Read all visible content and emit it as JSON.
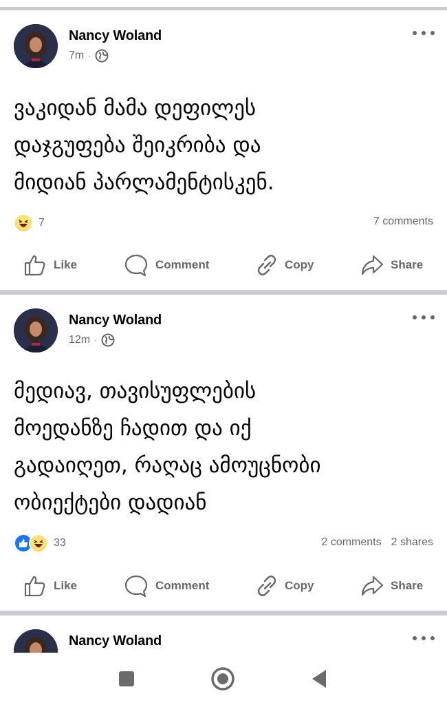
{
  "posts": [
    {
      "author": "Nancy Woland",
      "time": "7m",
      "separator": "·",
      "text": "ვაკიდან მამა დეფილეს\nდაჯგუფება შეიკრიბა და\nმიდიან პარლამენტისკენ.",
      "reaction_count": "7",
      "reactions": [
        "haha"
      ],
      "comments": "7 comments",
      "shares": ""
    },
    {
      "author": "Nancy Woland",
      "time": "12m",
      "separator": "·",
      "text": "მედიავ, თავისუფლების\nმოედანზე ჩადით და იქ\nგადაიღეთ, რაღაც ამოუცნობი\nობიექტები დადიან",
      "reaction_count": "33",
      "reactions": [
        "like",
        "haha"
      ],
      "comments": "2 comments",
      "shares": "2 shares"
    },
    {
      "author": "Nancy Woland"
    }
  ],
  "actions": {
    "like": "Like",
    "comment": "Comment",
    "copy": "Copy",
    "share": "Share"
  },
  "icons": {
    "privacy": "globe-icon",
    "more": "more-options-icon",
    "nav": [
      "recents-square-icon",
      "home-circle-icon",
      "back-triangle-icon"
    ]
  },
  "colors": {
    "secondary_text": "#65676b",
    "separator": "#c9ccd1",
    "like_blue": "#1877f2",
    "haha_yellow": "#f7b928"
  }
}
